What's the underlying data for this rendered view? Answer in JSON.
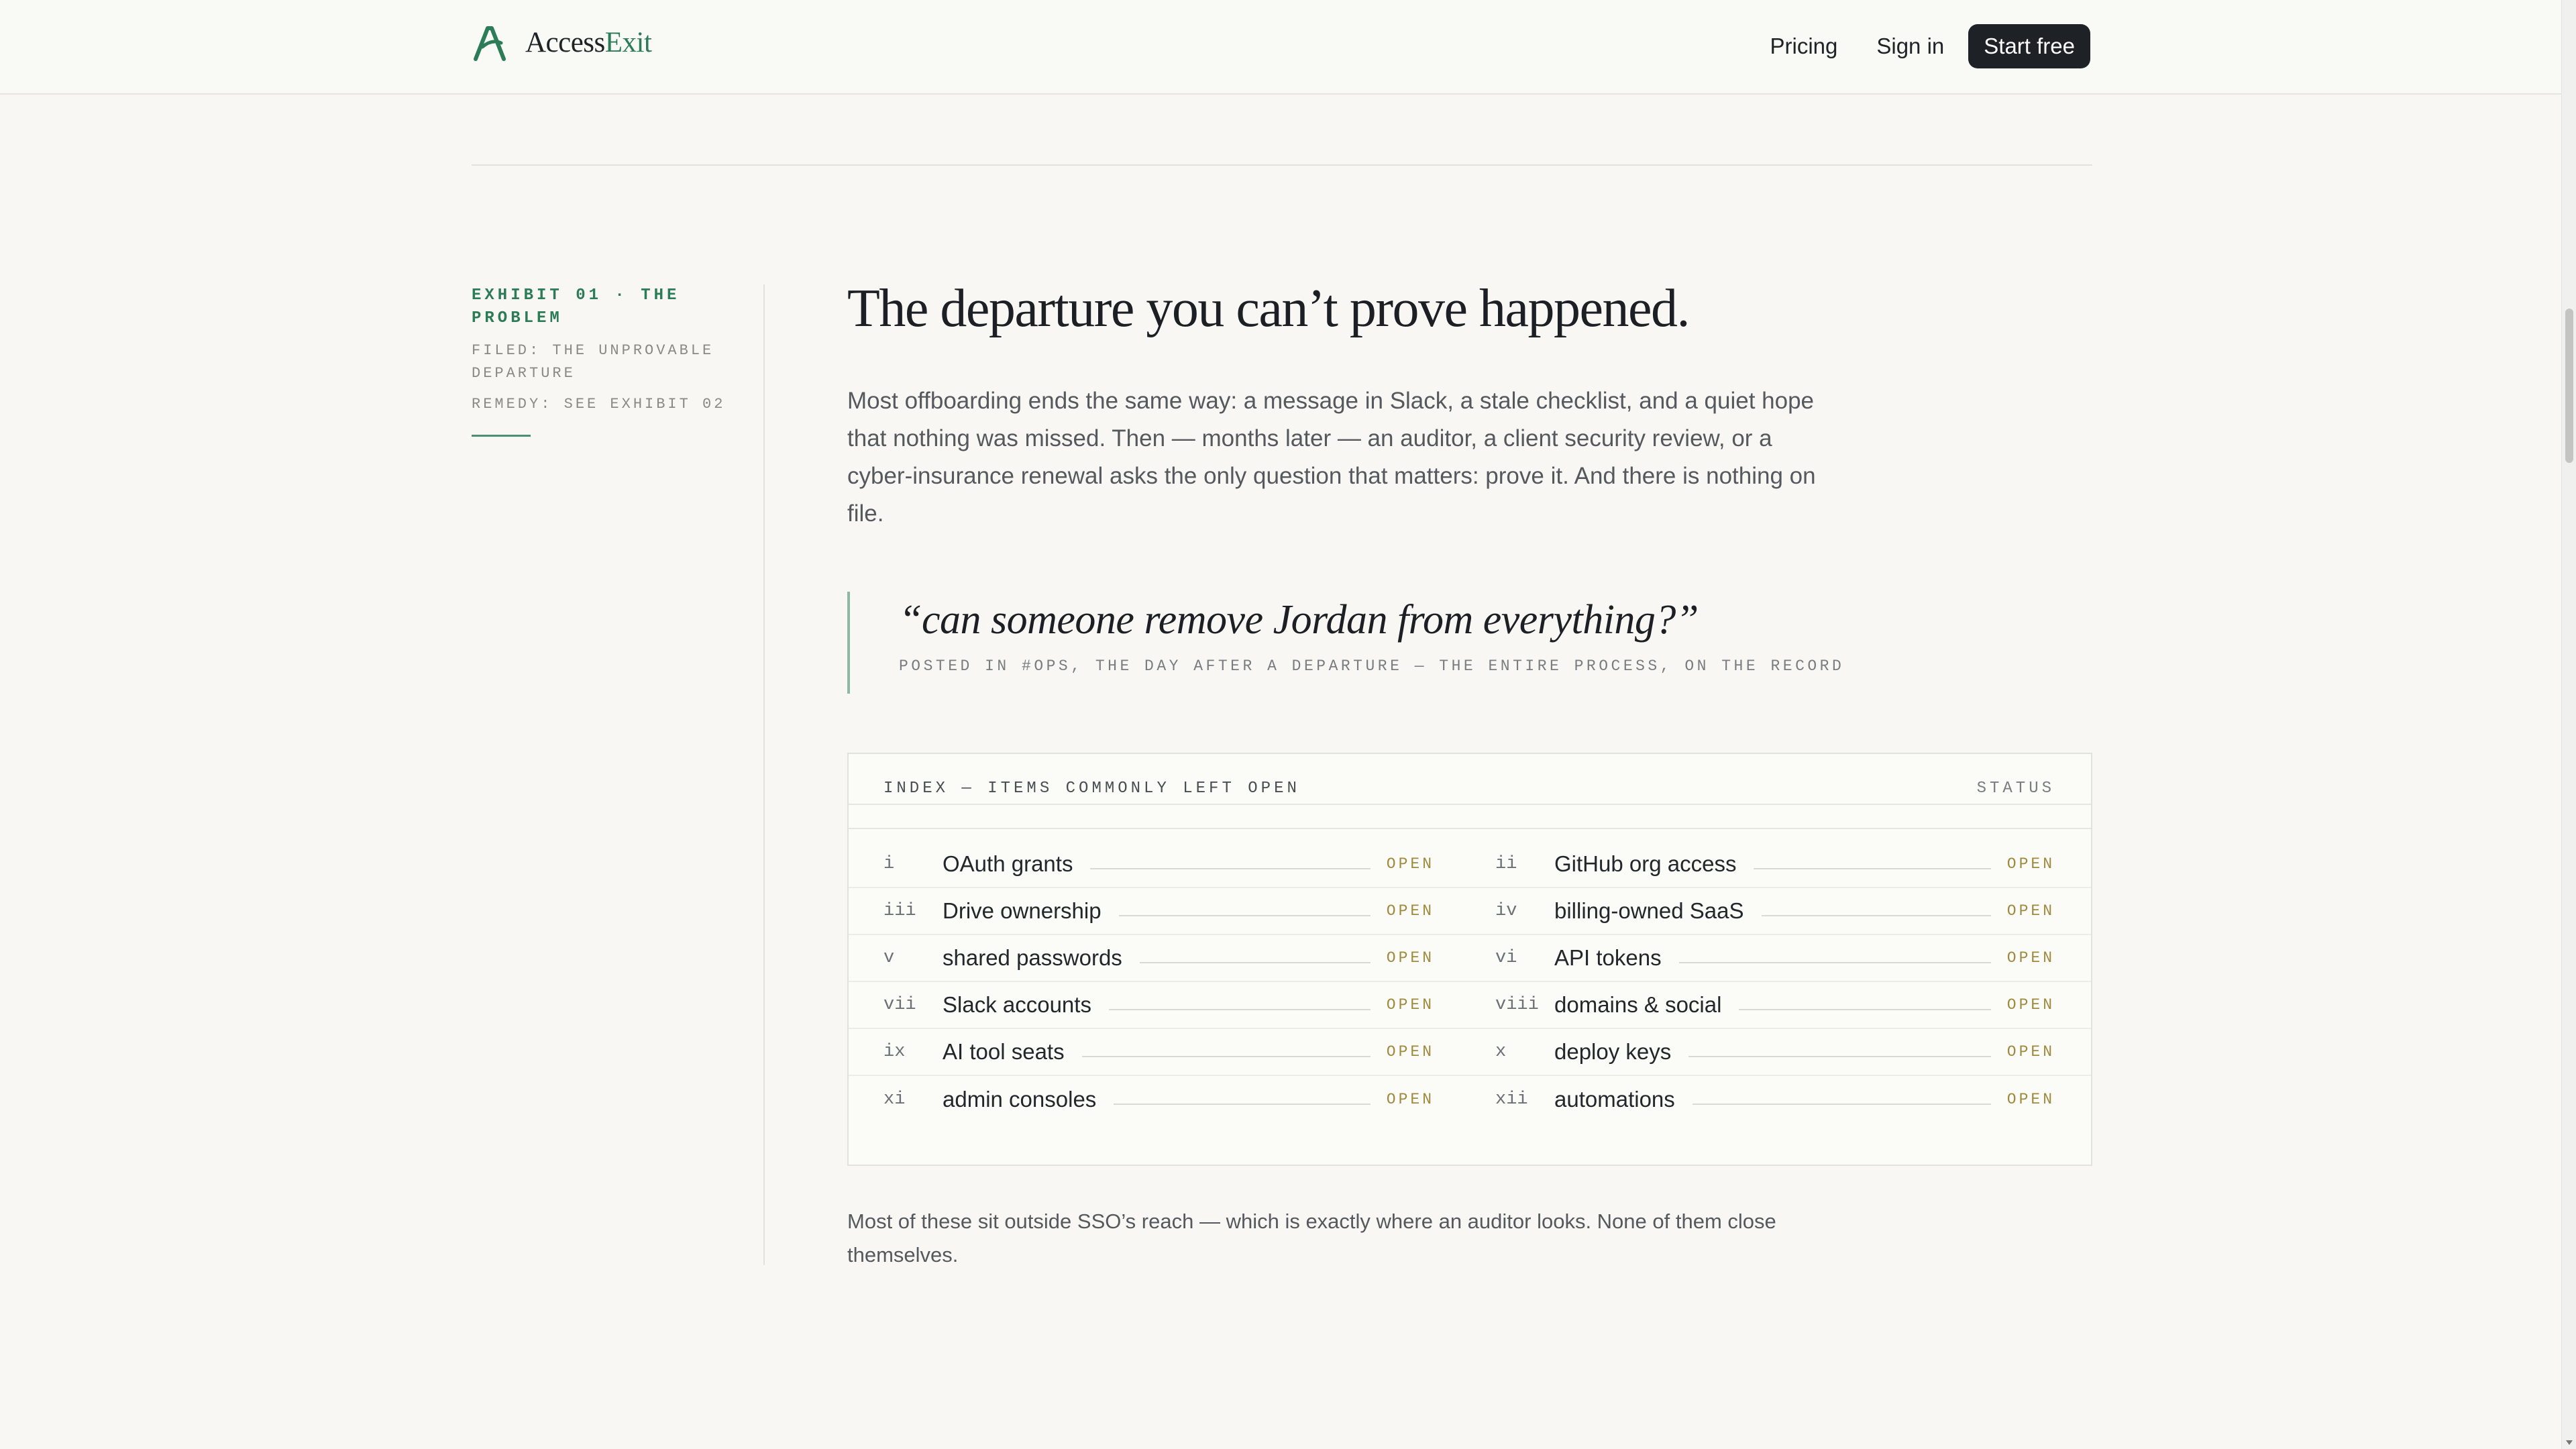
{
  "header": {
    "brand_first": "Access",
    "brand_accent": "Exit",
    "nav": {
      "pricing": "Pricing",
      "sign_in": "Sign in",
      "start_free": "Start free"
    }
  },
  "exhibit": {
    "label": "EXHIBIT 01 · THE PROBLEM",
    "filed": "FILED: THE UNPROVABLE DEPARTURE",
    "remedy": "REMEDY: SEE EXHIBIT 02"
  },
  "main": {
    "headline": "The departure you can’t prove happened.",
    "lede": "Most offboarding ends the same way: a message in Slack, a stale checklist, and a quiet hope that nothing was missed. Then — months later — an auditor, a client security review, or a cyber-insurance renewal asks the only question that matters: prove it. And there is nothing on file.",
    "quote": "“can someone remove Jordan from everything?”",
    "quote_caption": "POSTED IN #OPS, THE DAY AFTER A DEPARTURE — THE ENTIRE PROCESS, ON THE RECORD",
    "footnote": "Most of these sit outside SSO’s reach — which is exactly where an auditor looks. None of them close themselves."
  },
  "index": {
    "title": "INDEX — ITEMS COMMONLY LEFT OPEN",
    "status_header": "STATUS",
    "rows": [
      [
        {
          "num": "i",
          "label": "OAuth grants",
          "status": "OPEN"
        },
        {
          "num": "ii",
          "label": "GitHub org access",
          "status": "OPEN"
        }
      ],
      [
        {
          "num": "iii",
          "label": "Drive ownership",
          "status": "OPEN"
        },
        {
          "num": "iv",
          "label": "billing-owned SaaS",
          "status": "OPEN"
        }
      ],
      [
        {
          "num": "v",
          "label": "shared passwords",
          "status": "OPEN"
        },
        {
          "num": "vi",
          "label": "API tokens",
          "status": "OPEN"
        }
      ],
      [
        {
          "num": "vii",
          "label": "Slack accounts",
          "status": "OPEN"
        },
        {
          "num": "viii",
          "label": "domains & social",
          "status": "OPEN"
        }
      ],
      [
        {
          "num": "ix",
          "label": "AI tool seats",
          "status": "OPEN"
        },
        {
          "num": "x",
          "label": "deploy keys",
          "status": "OPEN"
        }
      ],
      [
        {
          "num": "xi",
          "label": "admin consoles",
          "status": "OPEN"
        },
        {
          "num": "xii",
          "label": "automations",
          "status": "OPEN"
        }
      ]
    ]
  },
  "colors": {
    "accent_green": "#2d7c58",
    "status_gold": "#a08a3e",
    "background": "#f8f7f3",
    "button_dark": "#1e2126"
  }
}
